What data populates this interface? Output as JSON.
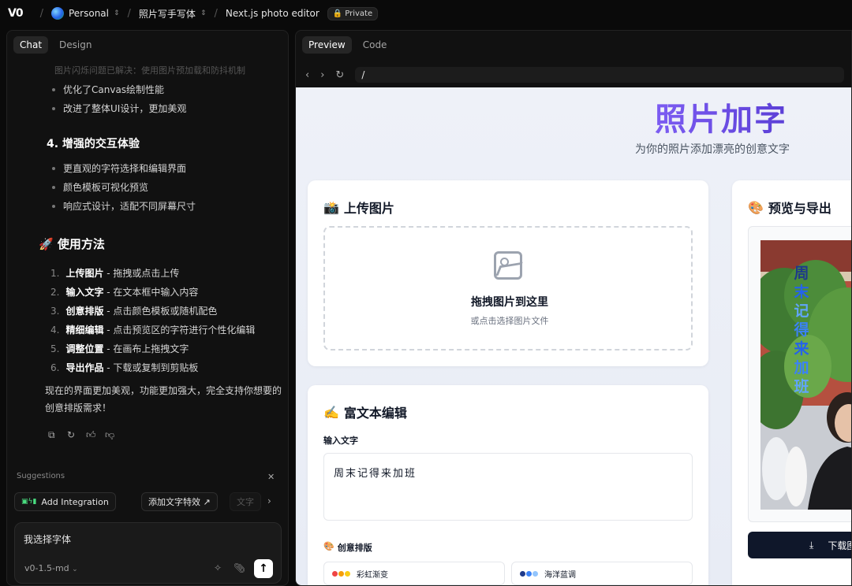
{
  "topbar": {
    "logo": "V0",
    "workspace": "Personal",
    "project": "照片写手写体",
    "chat_title": "Next.js photo editor",
    "visibility": "Private"
  },
  "chat": {
    "tabs": [
      "Chat",
      "Design"
    ],
    "faded_line": "图片闪烁问题已解决：使用图片预加载和防抖机制",
    "improve_items": [
      "优化了Canvas绘制性能",
      "改进了整体UI设计，更加美观"
    ],
    "section4_title": "4. 增强的交互体验",
    "section4_items": [
      "更直观的字符选择和编辑界面",
      "颜色模板可视化预览",
      "响应式设计，适配不同屏幕尺寸"
    ],
    "usage_title": "🚀 使用方法",
    "usage_steps": [
      {
        "num": "1.",
        "bold": "上传图片",
        "rest": " - 拖拽或点击上传"
      },
      {
        "num": "2.",
        "bold": "输入文字",
        "rest": " - 在文本框中输入内容"
      },
      {
        "num": "3.",
        "bold": "创意排版",
        "rest": " - 点击颜色模板或随机配色"
      },
      {
        "num": "4.",
        "bold": "精细编辑",
        "rest": " - 点击预览区的字符进行个性化编辑"
      },
      {
        "num": "5.",
        "bold": "调整位置",
        "rest": " - 在画布上拖拽文字"
      },
      {
        "num": "6.",
        "bold": "导出作品",
        "rest": " - 下载或复制到剪贴板"
      }
    ],
    "summary": "现在的界面更加美观，功能更加强大，完全支持你想要的创意排版需求！",
    "suggestions_label": "Suggestions",
    "suggestions": [
      "Add Integration",
      "添加文字特效 ↗",
      "文字"
    ],
    "input_value": "我选择字体",
    "model": "v0-1.5-md"
  },
  "preview": {
    "tabs": [
      "Preview",
      "Code"
    ],
    "url": "/",
    "app": {
      "title": "照片加字",
      "subtitle": "为你的照片添加漂亮的创意文字",
      "upload": {
        "title": "上传图片",
        "drop_title": "拖拽图片到这里",
        "drop_sub": "或点击选择图片文件"
      },
      "editor": {
        "title": "富文本编辑",
        "input_label": "输入文字",
        "input_value": "周末记得来加班",
        "layout_label": "创意排版",
        "templates": [
          {
            "name": "彩虹渐变",
            "colors": [
              "#ef4444",
              "#f59e0b",
              "#facc15"
            ]
          },
          {
            "name": "海洋蓝调",
            "colors": [
              "#1e3a8a",
              "#3b82f6",
              "#93c5fd"
            ]
          }
        ]
      },
      "export": {
        "title": "预览与导出",
        "overlay_chars": [
          "周",
          "末",
          "记",
          "得",
          "来",
          "加",
          "班"
        ],
        "overlay_colors": [
          "#1e3a8a",
          "#2563eb",
          "#3b82f6",
          "#60a5fa",
          "#3b82f6",
          "#2563eb",
          "#60a5fa"
        ],
        "download_label": "下载图"
      }
    }
  },
  "colors": {
    "accent": "#6d4ae0",
    "dark_bg": "#0a0a0a",
    "panel_bg": "#111111"
  }
}
